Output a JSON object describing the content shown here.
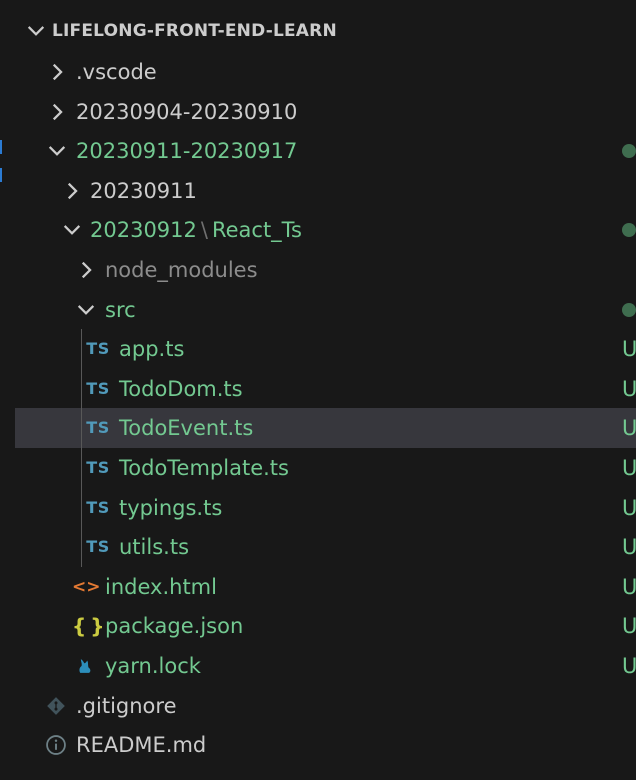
{
  "section": {
    "title": "LIFELONG-FRONT-END-LEARN"
  },
  "tree": [
    {
      "id": "vscode",
      "label": ".vscode",
      "kind": "folder",
      "expanded": false,
      "depth": 1,
      "color": "default"
    },
    {
      "id": "week1",
      "label": "20230904-20230910",
      "kind": "folder",
      "expanded": false,
      "depth": 1,
      "color": "default"
    },
    {
      "id": "week2",
      "label": "20230911-20230917",
      "kind": "folder",
      "expanded": true,
      "depth": 1,
      "color": "git",
      "dot": true
    },
    {
      "id": "d0911",
      "label": "20230911",
      "kind": "folder",
      "expanded": false,
      "depth": 2,
      "color": "default"
    },
    {
      "id": "d0912",
      "label": "20230912",
      "label2": "React_Ts",
      "kind": "folder",
      "expanded": true,
      "depth": 2,
      "color": "git",
      "dot": true
    },
    {
      "id": "node_modules",
      "label": "node_modules",
      "kind": "folder",
      "expanded": false,
      "depth": 3,
      "color": "muted"
    },
    {
      "id": "src",
      "label": "src",
      "kind": "folder",
      "expanded": true,
      "depth": 3,
      "color": "git",
      "dot": true
    },
    {
      "id": "app",
      "label": "app.ts",
      "kind": "file",
      "icon": "TS",
      "depth": 4,
      "color": "git",
      "status": "U"
    },
    {
      "id": "tododom",
      "label": "TodoDom.ts",
      "kind": "file",
      "icon": "TS",
      "depth": 4,
      "color": "git",
      "status": "U"
    },
    {
      "id": "todoevent",
      "label": "TodoEvent.ts",
      "kind": "file",
      "icon": "TS",
      "depth": 4,
      "color": "git",
      "status": "U",
      "selected": true
    },
    {
      "id": "todotemplate",
      "label": "TodoTemplate.ts",
      "kind": "file",
      "icon": "TS",
      "depth": 4,
      "color": "git",
      "status": "U"
    },
    {
      "id": "typings",
      "label": "typings.ts",
      "kind": "file",
      "icon": "TS",
      "depth": 4,
      "color": "git",
      "status": "U"
    },
    {
      "id": "utils",
      "label": "utils.ts",
      "kind": "file",
      "icon": "TS",
      "depth": 4,
      "color": "git",
      "status": "U"
    },
    {
      "id": "indexhtml",
      "label": "index.html",
      "kind": "file",
      "icon": "<>",
      "depth": 3,
      "color": "git",
      "status": "U"
    },
    {
      "id": "packagejson",
      "label": "package.json",
      "kind": "file",
      "icon": "{}",
      "depth": 3,
      "color": "git",
      "status": "U"
    },
    {
      "id": "yarnlock",
      "label": "yarn.lock",
      "kind": "file",
      "icon": "yarn",
      "depth": 3,
      "color": "git",
      "status": "U"
    },
    {
      "id": "gitignore",
      "label": ".gitignore",
      "kind": "file",
      "icon": "git",
      "depth": 1,
      "color": "default"
    },
    {
      "id": "readme",
      "label": "README.md",
      "kind": "file",
      "icon": "info",
      "depth": 1,
      "color": "default"
    }
  ],
  "colors": {
    "background": "#181818",
    "selected_row": "#37373d",
    "git_untracked": "#73c991",
    "ts_icon": "#519aba",
    "html_icon": "#e37933",
    "json_icon": "#cbcb41",
    "yarn_icon": "#2c8ebb"
  }
}
